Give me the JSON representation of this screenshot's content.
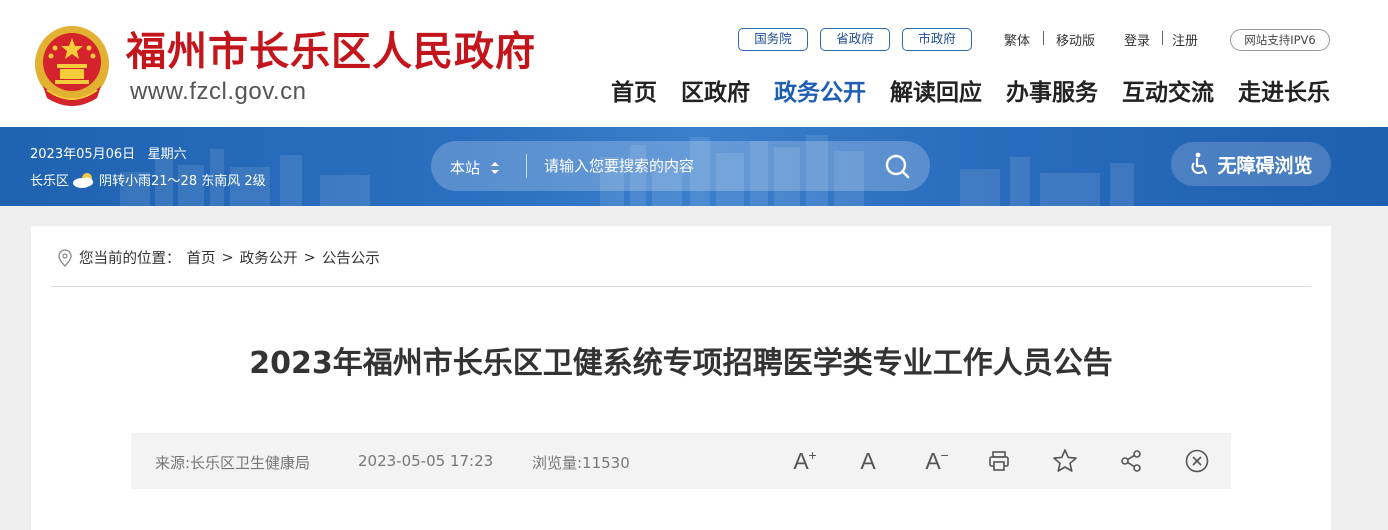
{
  "header": {
    "site_name": "福州市长乐区人民政府",
    "site_url": "www.fzcl.gov.cn",
    "gov_links": [
      "国务院",
      "省政府",
      "市政府"
    ],
    "utility": {
      "traditional": "繁体",
      "mobile": "移动版",
      "login": "登录",
      "register": "注册",
      "ipv6": "网站支持IPV6"
    },
    "nav": [
      "首页",
      "区政府",
      "政务公开",
      "解读回应",
      "办事服务",
      "互动交流",
      "走进长乐"
    ],
    "active_nav": "政务公开",
    "colors": {
      "brand_red": "#c3161c",
      "nav_active": "#1e5fb3",
      "banner_blue": "#2a6cbd"
    }
  },
  "banner": {
    "date": "2023年05月06日",
    "weekday": "星期六",
    "weather_area": "长乐区",
    "weather_icon": "cloud-sun-icon",
    "weather": "阴转小雨21～28 东南风 2级",
    "search": {
      "scope": "本站",
      "placeholder": "请输入您要搜索的内容"
    },
    "accessibility": "无障碍浏览"
  },
  "breadcrumb": {
    "prefix": "您当前的位置：",
    "items": [
      "首页",
      "政务公开",
      "公告公示"
    ],
    "separator": ">"
  },
  "article": {
    "title": "2023年福州市长乐区卫健系统专项招聘医学类专业工作人员公告",
    "source": "来源:长乐区卫生健康局",
    "datetime": "2023-05-05 17:23",
    "views": "浏览量:11530",
    "tools": {
      "font_large": "A",
      "font_normal": "A",
      "font_small": "A",
      "font_large_mark": "+",
      "font_small_mark": "−"
    }
  }
}
